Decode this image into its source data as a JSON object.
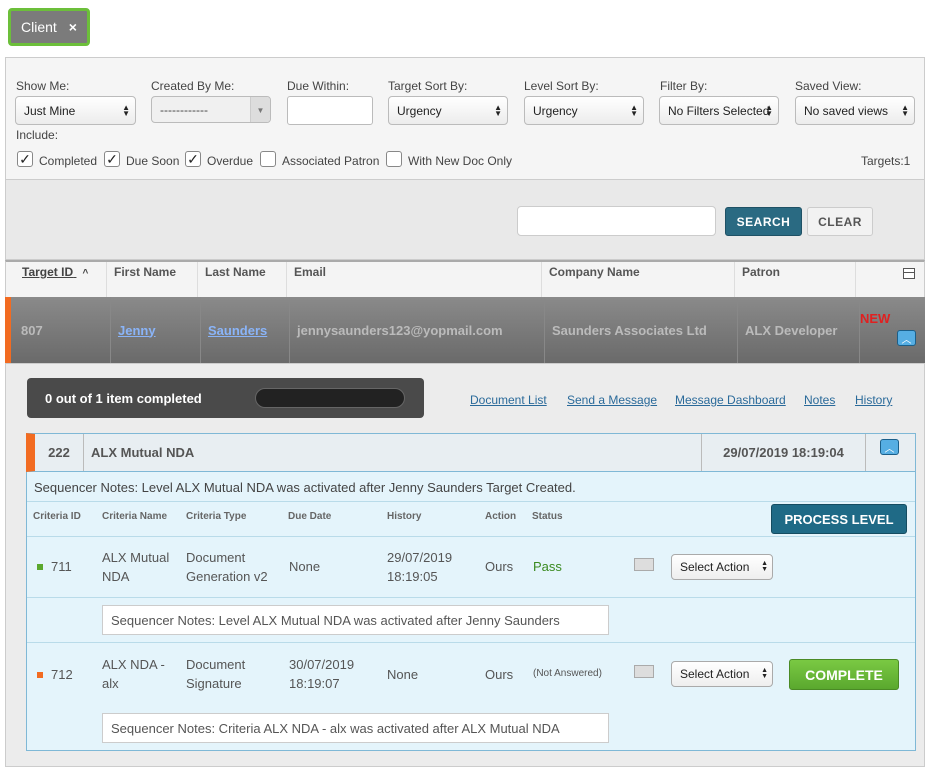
{
  "client_tag": {
    "label": "Client",
    "close": "×"
  },
  "filters": {
    "show_me": {
      "label": "Show Me:",
      "value": "Just Mine"
    },
    "created_by_me": {
      "label": "Created By Me:",
      "value": "------------"
    },
    "due_within": {
      "label": "Due Within:",
      "value": ""
    },
    "target_sort": {
      "label": "Target Sort By:",
      "value": "Urgency"
    },
    "level_sort": {
      "label": "Level Sort By:",
      "value": "Urgency"
    },
    "filter_by": {
      "label": "Filter By:",
      "value": "No Filters Selected"
    },
    "saved_view": {
      "label": "Saved View:",
      "value": "No saved views"
    },
    "include_label": "Include:",
    "checkboxes": [
      {
        "label": "Completed",
        "checked": true
      },
      {
        "label": "Due Soon",
        "checked": true
      },
      {
        "label": "Overdue",
        "checked": true
      },
      {
        "label": "Associated Patron",
        "checked": false
      },
      {
        "label": "With New Doc Only",
        "checked": false
      }
    ],
    "targets_count": "Targets:1"
  },
  "search": {
    "value": "",
    "search_label": "SEARCH",
    "clear_label": "CLEAR"
  },
  "table": {
    "headers": [
      "Target ID",
      "First Name",
      "Last Name",
      "Email",
      "Company Name",
      "Patron"
    ],
    "sort_indicator": "^",
    "row": {
      "target_id": "807",
      "first_name": "Jenny",
      "last_name": "Saunders",
      "email": "jennysaunders123@yopmail.com",
      "company": "Saunders Associates Ltd",
      "patron": "ALX Developer",
      "badge": "NEW"
    }
  },
  "detail": {
    "progress_text": "0 out of 1 item completed",
    "progress_fraction": 0,
    "links": [
      "Document List",
      "Send a Message",
      "Message Dashboard",
      "Notes",
      "History"
    ],
    "level": {
      "id": "222",
      "name": "ALX Mutual NDA",
      "datetime": "29/07/2019 18:19:04",
      "sequencer_note": "Sequencer Notes: Level ALX Mutual NDA was activated after Jenny Saunders Target Created.",
      "criteria_headers": [
        "Criteria ID",
        "Criteria Name",
        "Criteria Type",
        "Due Date",
        "History",
        "Action",
        "Status"
      ],
      "process_label": "PROCESS LEVEL",
      "criteria": [
        {
          "id": "711",
          "name_l1": "ALX Mutual",
          "name_l2": "NDA",
          "type_l1": "Document",
          "type_l2": "Generation v2",
          "due": "None",
          "hist_l1": "29/07/2019",
          "hist_l2": "18:19:05",
          "action": "Ours",
          "status": "Pass",
          "select": "Select Action",
          "note": "Sequencer Notes: Level ALX Mutual NDA was activated after Jenny Saunders",
          "dot_color": "#5aa82e"
        },
        {
          "id": "712",
          "name_l1": "ALX NDA -",
          "name_l2": "alx",
          "type_l1": "Document",
          "type_l2": "Signature",
          "due_l1": "30/07/2019",
          "due_l2": "18:19:07",
          "hist": "None",
          "action": "Ours",
          "status": "(Not Answered)",
          "select": "Select Action",
          "complete_label": "COMPLETE",
          "note": "Sequencer Notes: Criteria ALX NDA - alx was activated after ALX Mutual NDA",
          "dot_color": "#f26b21"
        }
      ]
    }
  },
  "colors": {
    "accent_orange": "#f26b21",
    "primary_blue": "#2a6a82",
    "success_green": "#5aa82e",
    "new_red": "#e02020"
  }
}
